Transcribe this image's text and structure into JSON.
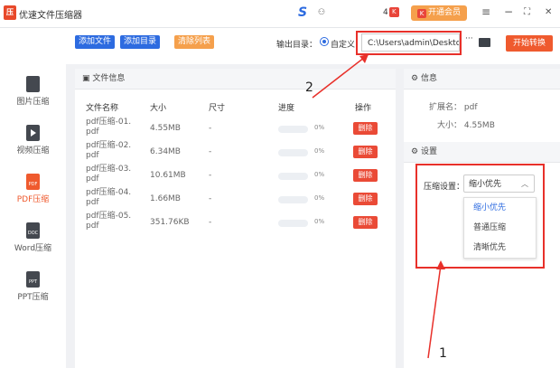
{
  "app": {
    "title": "优速文件压缩器",
    "coins": "4",
    "vip_label": "开通会员",
    "logo_glyph": "压"
  },
  "window": {
    "menu_icon": "≡",
    "minimize": "−",
    "maximize": "⛶",
    "close": "✕"
  },
  "toolbar": {
    "add_file": "添加文件",
    "add_dir": "添加目录",
    "clear_list": "清除列表",
    "output_label": "输出目录：",
    "radio_label": "自定义",
    "path": "C:\\Users\\admin\\Deskto",
    "more": "···",
    "start": "开始转换"
  },
  "sidebar": {
    "items": [
      {
        "label": "图片压缩",
        "icon_text": ""
      },
      {
        "label": "视频压缩",
        "icon_text": ""
      },
      {
        "label": "PDF压缩",
        "icon_text": "PDF"
      },
      {
        "label": "Word压缩",
        "icon_text": "DOC"
      },
      {
        "label": "PPT压缩",
        "icon_text": "PPT"
      }
    ],
    "active": "PDF压缩"
  },
  "file_panel": {
    "title": "文件信息",
    "columns": [
      "文件名称",
      "大小",
      "尺寸",
      "进度",
      "操作"
    ],
    "rows": [
      {
        "name1": "pdf压缩-01.",
        "name2": "pdf",
        "size": "4.55MB",
        "dim": "-",
        "progress": "0%",
        "action": "删除"
      },
      {
        "name1": "pdf压缩-02.",
        "name2": "pdf",
        "size": "6.34MB",
        "dim": "-",
        "progress": "0%",
        "action": "删除"
      },
      {
        "name1": "pdf压缩-03.",
        "name2": "pdf",
        "size": "10.61MB",
        "dim": "-",
        "progress": "0%",
        "action": "删除"
      },
      {
        "name1": "pdf压缩-04.",
        "name2": "pdf",
        "size": "1.66MB",
        "dim": "-",
        "progress": "0%",
        "action": "删除"
      },
      {
        "name1": "pdf压缩-05.",
        "name2": "pdf",
        "size": "351.76KB",
        "dim": "-",
        "progress": "0%",
        "action": "删除"
      }
    ]
  },
  "info_panel": {
    "title": "信息",
    "ext_label": "扩展名：",
    "ext_value": "pdf",
    "size_label": "大小：",
    "size_value": "4.55MB"
  },
  "settings_panel": {
    "title": "设置",
    "compress_label": "压缩设置：",
    "selected": "缩小优先",
    "options": [
      "缩小优先",
      "普通压缩",
      "清晰优先"
    ]
  },
  "annotations": {
    "one": "1",
    "two": "2"
  },
  "colors": {
    "accent_blue": "#2d6be0",
    "accent_orange": "#ef5a2e",
    "annotation_red": "#e8302a"
  }
}
